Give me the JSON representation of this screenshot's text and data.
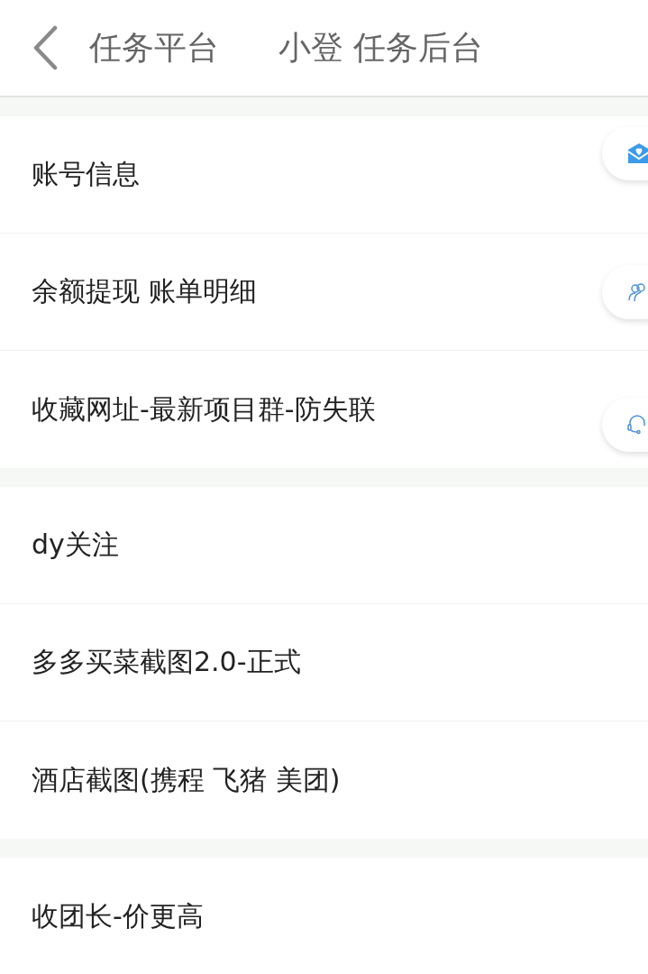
{
  "header": {
    "title": "任务平台",
    "subtitle": "小登 任务后台"
  },
  "groups": [
    {
      "items": [
        "账号信息",
        "余额提现 账单明细",
        "收藏网址-最新项目群-防失联"
      ]
    },
    {
      "items": [
        "dy关注",
        "多多买菜截图2.0-正式",
        "酒店截图(携程 飞猪 美团)"
      ]
    },
    {
      "items": [
        "收团长-价更高"
      ]
    }
  ]
}
